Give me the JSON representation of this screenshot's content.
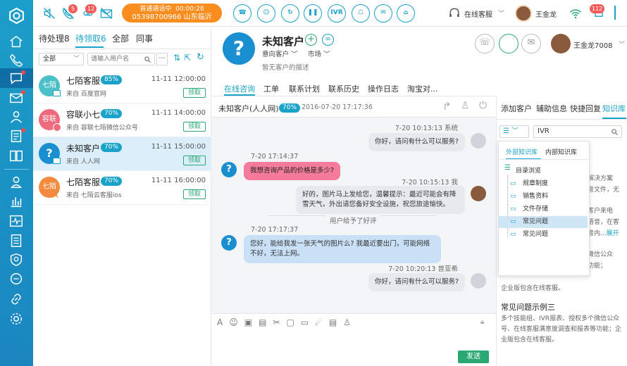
{
  "topbar": {
    "badges": {
      "missed": "5",
      "voicemail": "12",
      "notifications": "112"
    },
    "call": {
      "status": "普通通话中",
      "duration": "00:00:28",
      "number": "05398700966",
      "location": "山东临沂"
    },
    "controls": {
      "ivr": "IVR"
    },
    "service_status": "在线客服",
    "agent_name": "王金龙"
  },
  "list": {
    "tabs": [
      "待处理8",
      "待领取6",
      "全部",
      "同事"
    ],
    "filter_value": "全部",
    "search_placeholder": "请输入用户名",
    "rows": [
      {
        "avatar_text": "七陌",
        "avatar_color": "#4cc0c9",
        "name": "七陌客服",
        "pct": "85%",
        "time": "11-11 12:00:00",
        "source": "来自 百度官网",
        "claim": "领取"
      },
      {
        "avatar_text": "容联",
        "avatar_color": "#f06a7d",
        "name": "容联小七",
        "pct": "70%",
        "time": "11-11 14:00:00",
        "source": "来自 容联七陌微信公众号",
        "claim": "领取"
      },
      {
        "avatar_text": "?",
        "avatar_color": "#1a8fd0",
        "name": "未知客户",
        "pct": "70%",
        "time": "11-11 15:00:00",
        "source": "来自 人人网",
        "claim": "领取"
      },
      {
        "avatar_text": "七陌",
        "avatar_color": "#f48a3d",
        "name": "七陌客服",
        "pct": "70%",
        "time": "11-11 16:00:00",
        "source": "来自 七陌云客服ios",
        "claim": "领取"
      }
    ]
  },
  "customer": {
    "name": "未知客户",
    "tag1": "意向客户",
    "tag2": "市场",
    "desc": "暂无客户的描述",
    "agent_label": "王金龙7008",
    "tabs": [
      "在线咨询",
      "工单",
      "联系计划",
      "联系历史",
      "操作日志",
      "淘宝对..."
    ]
  },
  "chat": {
    "header_name": "未知客户(人人网)",
    "header_pct": "70%",
    "header_time": "2016-07-20 17:17:36",
    "messages": [
      {
        "meta": "7-20 10:13:13 系统",
        "text": "你好，请问有什么可以服务?"
      },
      {
        "meta": "7-20 17:14:37",
        "text": "我想咨询产品的价格是多少?"
      },
      {
        "meta": "7-20 10:15:13 我",
        "text": "好的，图片马上发给您，温馨提示：最近可能会有降雪天气，外出请您备好安全设施，祝您旅途愉快。"
      },
      {
        "meta": "用户给予了好评",
        "text": ""
      },
      {
        "meta": "7-20 17:17:37",
        "text": "您好，能给我发一张天气的图片么? 我最近要出门，可能网络不好，无法上网。"
      },
      {
        "meta": "7-20 10:20:13 曾亚希",
        "text": "你好，请问有什么可以服务?"
      }
    ],
    "send_label": "发送"
  },
  "right": {
    "tabs": [
      "添加客户",
      "辅助信息",
      "快捷回复",
      "知识库"
    ],
    "search_value": "IVR",
    "kb_tabs": [
      "外部知识库",
      "内部知识库"
    ],
    "browse_label": "目录浏览",
    "folders": [
      "规章制度",
      "销售资料",
      "文件存储",
      "常见问题",
      "常见问题"
    ],
    "bg_lines": [
      "音解决方案",
      "语音文件，无",
      "；客户来电",
      "户语音，在客",
      "语音内...",
      "展开",
      "个微信公众",
      "等功能；",
      "企业版包含在线客服。"
    ],
    "faq_title": "常见问题示例三",
    "faq_text": "多个技能组、IVR报表、授权多个微信公众号、在线客服满意度调查和报表等功能；企业版包含在线客服。"
  }
}
